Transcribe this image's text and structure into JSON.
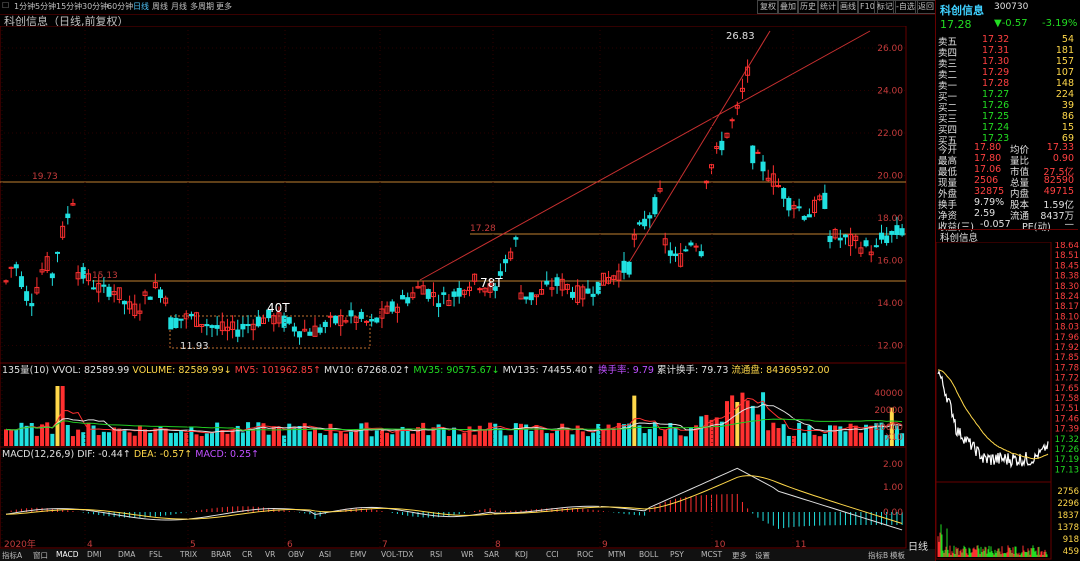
{
  "toolbar": {
    "left": [
      "1分钟",
      "5分钟",
      "15分钟",
      "30分钟",
      "60分钟",
      "日线",
      "周线",
      "月线",
      "多周期",
      "更多"
    ],
    "active": "日线",
    "right": [
      "复权",
      "叠加",
      "历史",
      "统计",
      "画线",
      "F10",
      "标记",
      "-自选",
      "返回"
    ]
  },
  "title": "科创信息（日线,前复权）",
  "price_axis": [
    "26.00",
    "24.00",
    "22.00",
    "20.00",
    "18.00",
    "16.00",
    "14.00",
    "12.00"
  ],
  "price_labels": {
    "high": "26.83",
    "low": "11.93",
    "level_1973": "19.73",
    "level_1728": "17.28",
    "level_1513": "15.13",
    "label_40T": "40T",
    "label_78T": "78T"
  },
  "volume_header": {
    "vol_name": "135量(10)",
    "vvol": "VVOL: 82589.99",
    "volume": "VOLUME: 82589.99↓",
    "mv5": "MV5: 101962.85↑",
    "mv10": "MV10: 67268.02↑",
    "mv35": "MV35: 90575.67↓",
    "mv135": "MV135: 74455.40↑",
    "turnover": "换手率: 9.79",
    "cum_turnover": "累计换手: 79.73",
    "float_cap": "流通盘: 84369592.00"
  },
  "volume_axis": [
    "40000",
    "20000",
    "10000",
    "X10"
  ],
  "macd_header": {
    "name": "MACD(12,26,9)",
    "dif": "DIF: -0.44↑",
    "dea": "DEA: -0.57↑",
    "macd": "MACD: 0.25↑"
  },
  "macd_axis": [
    "2.00",
    "1.00",
    "0.00"
  ],
  "month_labels": [
    "2020年",
    "4",
    "5",
    "6",
    "7",
    "8",
    "9",
    "10",
    "11"
  ],
  "bottom_tabs": [
    "指标A",
    "窗口",
    "MACD",
    "DMI",
    "DMA",
    "FSL",
    "TRIX",
    "BRAR",
    "CR",
    "VR",
    "OBV",
    "ASI",
    "EMV",
    "VOL-TDX",
    "RSI",
    "WR",
    "SAR",
    "KDJ",
    "CCI",
    "ROC",
    "MTM",
    "BOLL",
    "PSY",
    "MCST",
    "更多",
    "设置"
  ],
  "bottom_right": [
    "指标B",
    "模板"
  ],
  "period_label": "日线",
  "quote": {
    "name": "科创信息",
    "code": "300730",
    "price": "17.28",
    "change": "▼-0.57",
    "pct": "-3.19%",
    "asks": [
      {
        "label": "卖五",
        "price": "17.32",
        "vol": "54"
      },
      {
        "label": "卖四",
        "price": "17.31",
        "vol": "181"
      },
      {
        "label": "卖三",
        "price": "17.30",
        "vol": "157"
      },
      {
        "label": "卖二",
        "price": "17.29",
        "vol": "107"
      },
      {
        "label": "卖一",
        "price": "17.28",
        "vol": "148"
      }
    ],
    "bids": [
      {
        "label": "买一",
        "price": "17.27",
        "vol": "224"
      },
      {
        "label": "买二",
        "price": "17.26",
        "vol": "39"
      },
      {
        "label": "买三",
        "price": "17.25",
        "vol": "86"
      },
      {
        "label": "买四",
        "price": "17.24",
        "vol": "15"
      },
      {
        "label": "买五",
        "price": "17.23",
        "vol": "69"
      }
    ],
    "stats": [
      {
        "l1": "今开",
        "v1": "17.80",
        "l2": "均价",
        "v2": "17.33"
      },
      {
        "l1": "最高",
        "v1": "17.80",
        "l2": "量比",
        "v2": "0.90"
      },
      {
        "l1": "最低",
        "v1": "17.06",
        "l2": "市值",
        "v2": "27.5亿"
      },
      {
        "l1": "现量",
        "v1": "2506",
        "l2": "总量",
        "v2": "82590"
      },
      {
        "l1": "外盘",
        "v1": "32875",
        "l2": "内盘",
        "v2": "49715"
      }
    ],
    "stats2": [
      {
        "l1": "换手",
        "v1": "9.79%",
        "l2": "股本",
        "v2": "1.59亿"
      },
      {
        "l1": "净资",
        "v1": "2.59",
        "l2": "流通",
        "v2": "8437万"
      },
      {
        "l1": "收益(三)",
        "v1": "-0.057",
        "l2": "PE(动)",
        "v2": "—"
      }
    ],
    "mini_title": "科创信息",
    "mini_axis": [
      "18.64",
      "18.51",
      "18.45",
      "18.38",
      "18.30",
      "18.24",
      "18.17",
      "18.10",
      "18.03",
      "17.96",
      "17.92",
      "17.85",
      "17.78",
      "17.72",
      "17.65",
      "17.58",
      "17.51",
      "17.46",
      "17.39",
      "17.32",
      "17.26",
      "17.19",
      "17.13"
    ],
    "mini_vol_axis": [
      "2756",
      "2296",
      "1837",
      "1378",
      "918",
      "459"
    ]
  }
}
